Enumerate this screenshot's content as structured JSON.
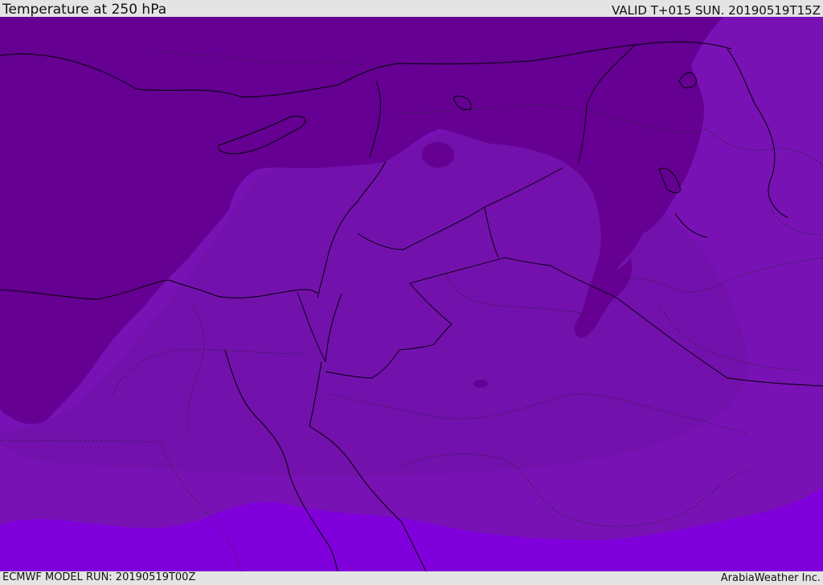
{
  "header": {
    "title": "Temperature at 250 hPa",
    "valid": "VALID T+015 SUN. 20190519T15Z"
  },
  "footer": {
    "model_run": "ECMWF MODEL RUN: 20190519T00Z",
    "credit": "ArabiaWeather Inc."
  },
  "map": {
    "field": "temperature",
    "level": "250 hPa",
    "colors": {
      "coldest": "#650093",
      "cold": "#7311ad",
      "mid": "#7812b5",
      "warm": "#8000dc",
      "border": "#000000",
      "province_border": "#222222"
    },
    "icons": [
      "coastline-icon",
      "country-border-icon",
      "province-border-icon"
    ]
  }
}
